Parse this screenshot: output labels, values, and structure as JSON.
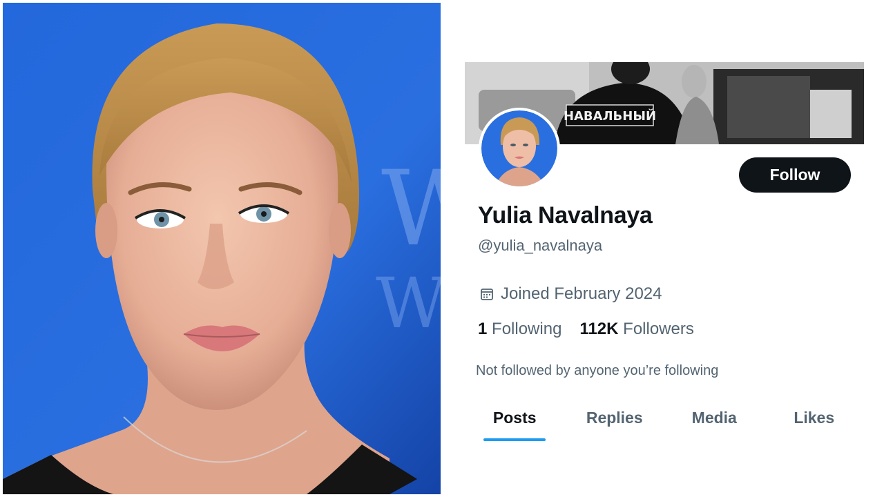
{
  "portrait": {
    "icon": "portrait-photo"
  },
  "profile": {
    "banner_jacket_text": "НАВАЛЬНЫЙ",
    "follow_label": "Follow",
    "display_name": "Yulia Navalnaya",
    "handle": "@yulia_navalnaya",
    "joined": "Joined February 2024",
    "following_count": "1",
    "following_label": "Following",
    "followers_count": "112K",
    "followers_label": "Followers",
    "not_followed": "Not followed by anyone you’re following",
    "tabs": [
      {
        "label": "Posts",
        "active": true
      },
      {
        "label": "Replies",
        "active": false
      },
      {
        "label": "Media",
        "active": false
      },
      {
        "label": "Likes",
        "active": false
      }
    ]
  },
  "colors": {
    "accent": "#1d9bf0",
    "text_primary": "#0f1419",
    "text_secondary": "#536471",
    "button_bg": "#0f1419",
    "portrait_bg": "#2a6fe0"
  }
}
